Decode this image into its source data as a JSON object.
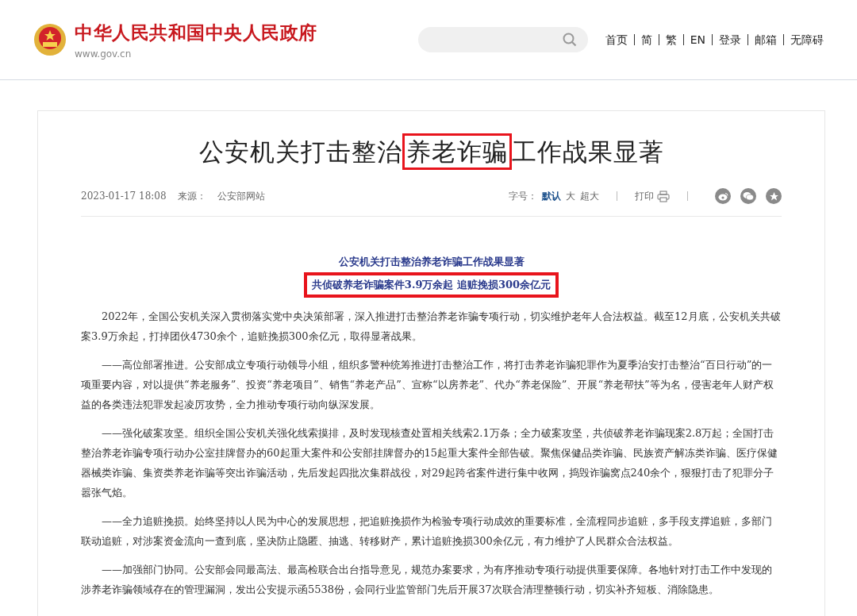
{
  "header": {
    "site_name": "中华人民共和国中央人民政府",
    "site_url": "www.gov.cn",
    "nav": [
      {
        "label": "首页"
      },
      {
        "label": "简"
      },
      {
        "label": "繁"
      },
      {
        "label": "EN"
      },
      {
        "label": "登录"
      },
      {
        "label": "邮箱"
      },
      {
        "label": "无障碍"
      }
    ]
  },
  "article": {
    "title_parts": [
      {
        "text": "公安机关打击整治",
        "highlighted": false
      },
      {
        "text": "养老诈骗",
        "highlighted": true
      },
      {
        "text": "工作战果显著",
        "highlighted": false
      }
    ],
    "date": "2023-01-17 18:08",
    "source_label": "来源：",
    "source": "公安部网站",
    "font_size_label": "字号：",
    "font_sizes": [
      {
        "label": "默认",
        "selected": true
      },
      {
        "label": "大",
        "selected": false
      },
      {
        "label": "超大",
        "selected": false
      }
    ],
    "print_label": "打印",
    "share": [
      {
        "kind": "weibo"
      },
      {
        "kind": "wechat"
      },
      {
        "kind": "favorite"
      }
    ],
    "subtitles": [
      {
        "text": "公安机关打击整治养老诈骗工作战果显著",
        "highlighted": false
      },
      {
        "text": "共侦破养老诈骗案件3.9万余起  追赃挽损300余亿元",
        "highlighted": true
      }
    ],
    "paragraphs": [
      "2022年，全国公安机关深入贯彻落实党中央决策部署，深入推进打击整治养老诈骗专项行动，切实维护老年人合法权益。截至12月底，公安机关共破案3.9万余起，打掉团伙4730余个，追赃挽损300余亿元，取得显著战果。",
      "——高位部署推进。公安部成立专项行动领导小组，组织多警种统筹推进打击整治工作，将打击养老诈骗犯罪作为夏季治安打击整治“百日行动”的一项重要内容，对以提供“养老服务”、投资“养老项目”、销售“养老产品”、宣称“以房养老”、代办“养老保险”、开展“养老帮扶”等为名，侵害老年人财产权益的各类违法犯罪发起凌厉攻势，全力推动专项行动向纵深发展。",
      "——强化破案攻坚。组织全国公安机关强化线索摸排，及时发现核查处置相关线索2.1万条；全力破案攻坚，共侦破养老诈骗现案2.8万起；全国打击整治养老诈骗专项行动办公室挂牌督办的60起重大案件和公安部挂牌督办的15起重大案件全部告破。聚焦保健品类诈骗、民族资产解冻类诈骗、医疗保健器械类诈骗、集资类养老诈骗等突出诈骗活动，先后发起四批次集群战役，对29起跨省案件进行集中收网，捣毁诈骗窝点240余个，狠狠打击了犯罪分子嚣张气焰。",
      "——全力追赃挽损。始终坚持以人民为中心的发展思想，把追赃挽损作为检验专项行动成效的重要标准，全流程同步追赃，多手段支撑追赃，多部门联动追赃，对涉案资金流向一查到底，坚决防止隐匿、抽逃、转移财产，累计追赃挽损300余亿元，有力维护了人民群众合法权益。",
      "——加强部门协同。公安部会同最高法、最高检联合出台指导意见，规范办案要求，为有序推动专项行动提供重要保障。各地针对打击工作中发现的涉养老诈骗领域存在的管理漏洞，发出公安提示函5538份，会同行业监管部门先后开展37次联合清理整顿行动，切实补齐短板、消除隐患。"
    ]
  }
}
